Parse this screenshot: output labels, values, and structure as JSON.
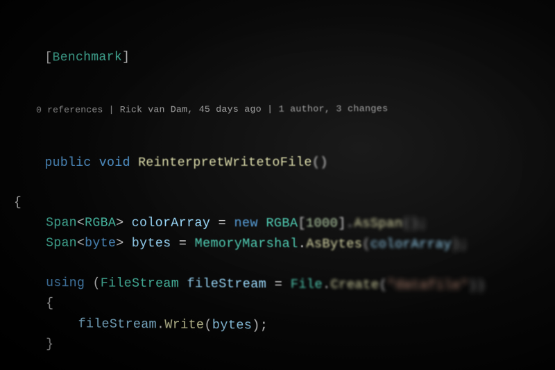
{
  "code": {
    "attribute_open": "[",
    "attribute_name": "Benchmark",
    "attribute_close": "]",
    "codelens_refs": "0 references",
    "codelens_sep": " | ",
    "codelens_author": "Rick van Dam, 45 days ago",
    "codelens_changes": "1 author, 3 changes",
    "kw_public": "public",
    "kw_void": "void",
    "method_name": "ReinterpretWritetoFile",
    "parens_empty": "()",
    "brace_open": "{",
    "brace_close": "}",
    "l1_type1": "Span",
    "l1_lt": "<",
    "l1_gen": "RGBA",
    "l1_gt": ">",
    "l1_var": "colorArray",
    "l1_eq": " = ",
    "l1_new": "new",
    "l1_rgba": "RGBA",
    "l1_ob": "[",
    "l1_num": "1000",
    "l1_cb": "]",
    "l1_dot": ".",
    "l1_asspan": "AsSpan",
    "l1_call": "()",
    "l1_semi": ";",
    "l2_type1": "Span",
    "l2_lt": "<",
    "l2_gen": "byte",
    "l2_gt": ">",
    "l2_var": "bytes",
    "l2_eq": " = ",
    "l2_mm": "MemoryMarshal",
    "l2_dot": ".",
    "l2_asbytes": "AsBytes",
    "l2_op": "(",
    "l2_arg": "colorArray",
    "l2_cp": ")",
    "l2_semi": ";",
    "l3_using": "using",
    "l3_op": " (",
    "l3_fs": "FileStream",
    "l3_sp": " ",
    "l3_var": "fileStream",
    "l3_eq": " = ",
    "l3_file": "File",
    "l3_dot": ".",
    "l3_create": "Create",
    "l3_cop": "(",
    "l3_str": "\"datafile\"",
    "l3_ccp": "))",
    "l4_var": "fileStream",
    "l4_dot": ".",
    "l4_write": "Write",
    "l4_op": "(",
    "l4_arg": "bytes",
    "l4_cp": ")",
    "l4_semi": ";"
  }
}
